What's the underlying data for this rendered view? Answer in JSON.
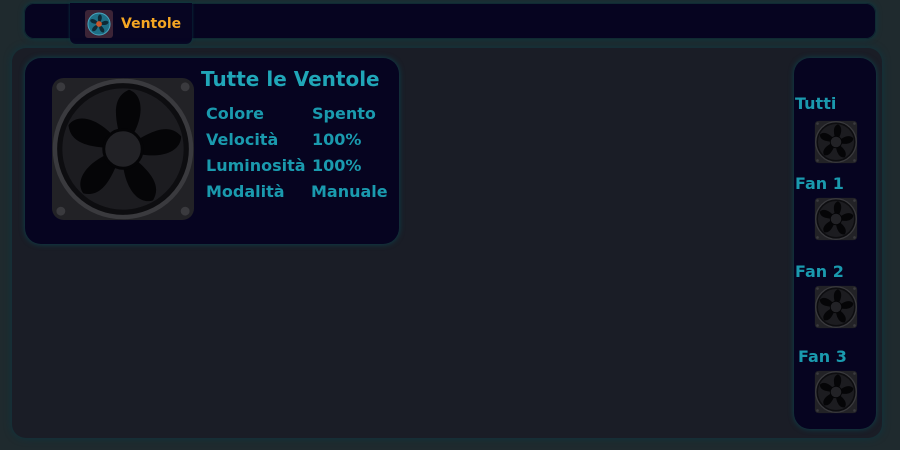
{
  "tab": {
    "label": "Ventole",
    "icon": "fan-icon",
    "accent_color": "#f5a623"
  },
  "card": {
    "title": "Tutte le Ventole",
    "icon": "fan-icon",
    "properties": [
      {
        "key": "Colore",
        "value": "Spento"
      },
      {
        "key": "Velocità",
        "value": "100%"
      },
      {
        "key": "Luminosità",
        "value": "100%"
      },
      {
        "key": "Modalità",
        "value": "Manuale"
      }
    ]
  },
  "fans": [
    {
      "label": "Tutti",
      "icon": "fan-icon"
    },
    {
      "label": "Fan 1",
      "icon": "fan-icon"
    },
    {
      "label": "Fan 2",
      "icon": "fan-icon"
    },
    {
      "label": "Fan 3",
      "icon": "fan-icon"
    }
  ],
  "colors": {
    "text_accent": "#1a9aae",
    "panel_bg": "#060420",
    "app_bg": "#1a1d26"
  }
}
